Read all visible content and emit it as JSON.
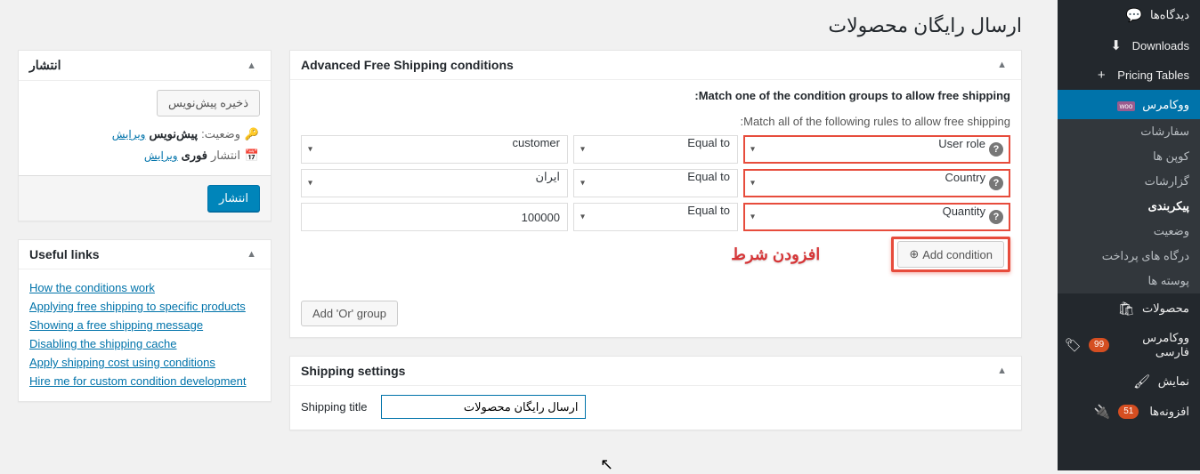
{
  "sidebar": {
    "items": [
      {
        "label": "دیدگاه‌ها",
        "icon": "💬"
      },
      {
        "label": "Downloads",
        "icon": "⬇"
      },
      {
        "label": "Pricing Tables",
        "icon": "+"
      }
    ],
    "woo": {
      "label": "ووکامرس",
      "icon": "woo"
    },
    "woo_sub": [
      "سفارشات",
      "کوپن ها",
      "گزارشات",
      "پیکربندی",
      "وضعیت",
      "درگاه های پرداخت",
      "پوسته ها"
    ],
    "woo_sub_current_index": 3,
    "after": [
      {
        "label": "محصولات",
        "icon": "🛍"
      },
      {
        "label": "ووکامرس فارسی",
        "icon": "🏷",
        "badge": "99"
      },
      {
        "label": "نمایش",
        "icon": "🖌"
      },
      {
        "label": "افزونه‌ها",
        "icon": "🔌",
        "badge": "51"
      }
    ]
  },
  "page_title": "ارسال رایگان محصولات",
  "conditions_box": {
    "title": "Advanced Free Shipping conditions",
    "subtitle": "Match one of the condition groups to allow free shipping:",
    "group_desc": "Match all of the following rules to allow free shipping",
    "rows": [
      {
        "field": "User role",
        "op": "Equal to",
        "value": "customer",
        "val_is_select": true
      },
      {
        "field": "Country",
        "op": "Equal to",
        "value": "ایران",
        "val_is_select": true
      },
      {
        "field": "Quantity",
        "op": "Equal to",
        "value": "100000",
        "val_is_select": false
      }
    ],
    "add_condition": "Add condition",
    "add_annotation": "افزودن شرط",
    "add_or": "Add 'Or' group"
  },
  "shipping_box": {
    "title": "Shipping settings",
    "field_label": "Shipping title",
    "field_value": "ارسال رایگان محصولات"
  },
  "publish_box": {
    "title": "انتشار",
    "save_draft": "ذخیره پیش‌نویس",
    "status_label": "وضعیت:",
    "status_value": "پیش‌نویس",
    "edit": "ویرایش",
    "visibility_label": "انتشار",
    "visibility_value": "فوری",
    "publish_btn": "انتشار"
  },
  "links_box": {
    "title": "Useful links",
    "links": [
      "How the conditions work",
      "Applying free shipping to specific products",
      "Showing a free shipping message",
      "Disabling the shipping cache",
      "Apply shipping cost using conditions",
      "Hire me for custom condition development"
    ]
  }
}
